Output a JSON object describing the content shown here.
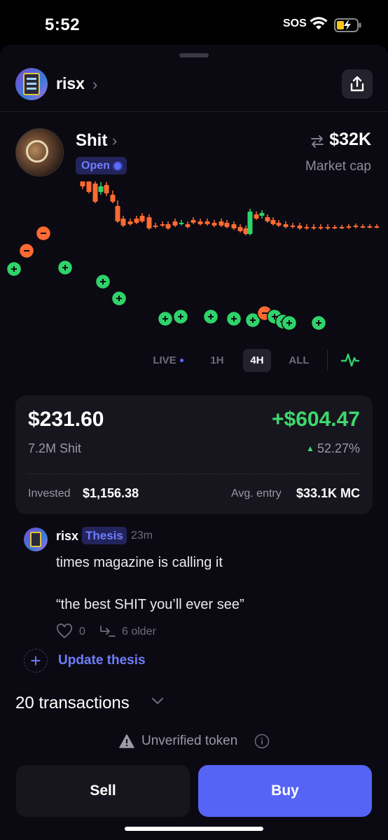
{
  "status_bar": {
    "time": "5:52",
    "sos": "SOS"
  },
  "header": {
    "username": "risx",
    "share_icon": "share-icon"
  },
  "token": {
    "name": "Shit",
    "status": "Open",
    "market_cap_value": "$32K",
    "market_cap_label": "Market cap"
  },
  "chart_data": {
    "type": "candlestick",
    "up_color": "#2fd36a",
    "down_color": "#ff6a32",
    "buy_marker_color": "#2fd36a",
    "sell_marker_color": "#ff6a32"
  },
  "ranges": {
    "live": "LIVE",
    "h1": "1H",
    "h4": "4H",
    "all": "ALL",
    "active": "4H"
  },
  "position": {
    "value": "$231.60",
    "pnl": "+$604.47",
    "amount": "7.2M Shit",
    "pnl_pct": "52.27%",
    "invested_label": "Invested",
    "invested_value": "$1,156.38",
    "avg_entry_label": "Avg. entry",
    "avg_entry_value": "$33.1K MC"
  },
  "thesis": {
    "author": "risx",
    "badge": "Thesis",
    "time": "23m",
    "line1": "times magazine is calling it",
    "line2": "“the best SHIT you’ll ever see”",
    "likes": "0",
    "older": "6 older",
    "update_label": "Update thesis"
  },
  "transactions": {
    "label": "20 transactions"
  },
  "warning": {
    "text": "Unverified token"
  },
  "actions": {
    "sell": "Sell",
    "buy": "Buy"
  },
  "colors": {
    "accent": "#5564f5",
    "positive": "#3ed86d",
    "negative": "#ff6a32"
  }
}
